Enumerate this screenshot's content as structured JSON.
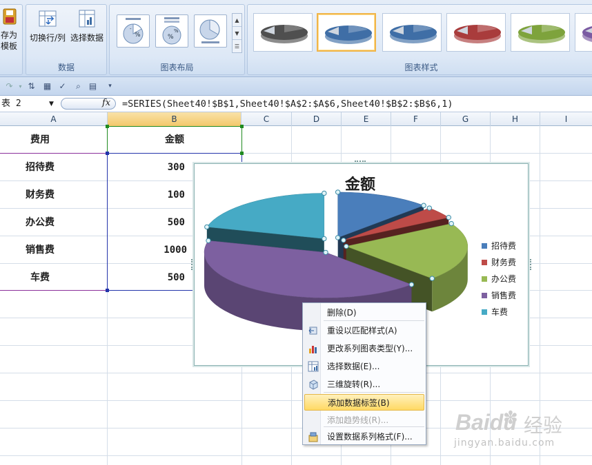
{
  "ribbon": {
    "save_template": {
      "line1": "存为",
      "line2": "模板"
    },
    "switch_row_col": "切换行/列",
    "select_data": "选择数据",
    "group_data": "数据",
    "group_layout": "图表布局",
    "group_styles": "图表样式",
    "style_colors": [
      "#4f4f4f",
      "#3f6ea6",
      "#3f6ea6",
      "#a93c3c",
      "#7ea33c",
      "#7a5aa2"
    ]
  },
  "formula_bar": {
    "name_box": "表 2",
    "fx_label": "fx",
    "formula": "=SERIES(Sheet40!$B$1,Sheet40!$A$2:$A$6,Sheet40!$B$2:$B$6,1)"
  },
  "sheet": {
    "columns": [
      "A",
      "B",
      "C",
      "D",
      "E",
      "F",
      "G",
      "H",
      "I"
    ],
    "header": {
      "a": "费用",
      "b": "金额"
    },
    "rows": [
      {
        "label": "招待费",
        "value": "300"
      },
      {
        "label": "财务费",
        "value": "100"
      },
      {
        "label": "办公费",
        "value": "500"
      },
      {
        "label": "销售费",
        "value": "1000"
      },
      {
        "label": "车费",
        "value": "500"
      }
    ]
  },
  "chart_data": {
    "type": "pie",
    "title": "金额",
    "categories": [
      "招待费",
      "财务费",
      "办公费",
      "销售费",
      "车费"
    ],
    "values": [
      300,
      100,
      500,
      1000,
      500
    ],
    "colors": [
      "#4a7ebb",
      "#be4b48",
      "#98b954",
      "#7d60a0",
      "#46aac5"
    ],
    "legend_position": "right",
    "exploded": true,
    "three_d": true
  },
  "context_menu": {
    "items": [
      {
        "label": "删除(D)",
        "icon": "none",
        "state": "normal"
      },
      {
        "label": "重设以匹配样式(A)",
        "icon": "reset-style-icon",
        "state": "normal"
      },
      {
        "label": "更改系列图表类型(Y)...",
        "icon": "chart-type-icon",
        "state": "normal"
      },
      {
        "label": "选择数据(E)...",
        "icon": "select-data-icon",
        "state": "normal"
      },
      {
        "label": "三维旋转(R)...",
        "icon": "rotate-3d-icon",
        "state": "normal"
      },
      {
        "label": "添加数据标签(B)",
        "icon": "none",
        "state": "highlighted"
      },
      {
        "label": "添加趋势线(R)...",
        "icon": "none",
        "state": "disabled"
      },
      {
        "label": "设置数据系列格式(F)...",
        "icon": "format-series-icon",
        "state": "normal"
      }
    ]
  },
  "watermark": {
    "brand": "Baidu",
    "brand_cn": "经验",
    "url": "jingyan.baidu.com"
  }
}
